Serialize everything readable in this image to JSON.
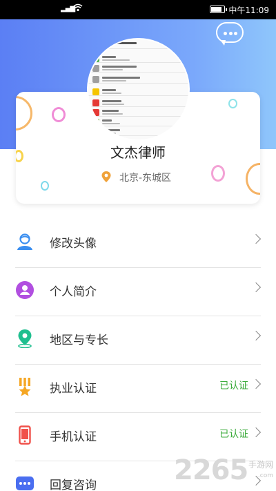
{
  "status_bar": {
    "signal": "⁴ᵍ",
    "wifi": "◔",
    "time": "中午11:09",
    "battery_level": 0.85
  },
  "header": {
    "chat_icon": "chat-bubble-icon"
  },
  "profile": {
    "name": "文杰律师",
    "location": "北京-东城区",
    "location_icon": "map-pin-icon"
  },
  "menu": [
    {
      "label": "修改头像",
      "status": "",
      "icon": "user-avatar-icon",
      "color": "#3a8ef0"
    },
    {
      "label": "个人简介",
      "status": "",
      "icon": "user-circle-icon",
      "color": "#b14fe0"
    },
    {
      "label": "地区与专长",
      "status": "",
      "icon": "location-icon",
      "color": "#1fbf8f"
    },
    {
      "label": "执业认证",
      "status": "已认证",
      "icon": "badge-icon",
      "color": "#f5a623"
    },
    {
      "label": "手机认证",
      "status": "已认证",
      "icon": "phone-icon",
      "color": "#f0514a"
    },
    {
      "label": "回复咨询",
      "status": "",
      "icon": "message-dots-icon",
      "color": "#4a6ef0"
    }
  ],
  "watermark": {
    "number": "2265",
    "text": "手游网",
    "url": ".com"
  },
  "colors": {
    "accent_gradient_start": "#5b7ff4",
    "accent_gradient_end": "#8fc6fb",
    "verified": "#3bab3b"
  }
}
